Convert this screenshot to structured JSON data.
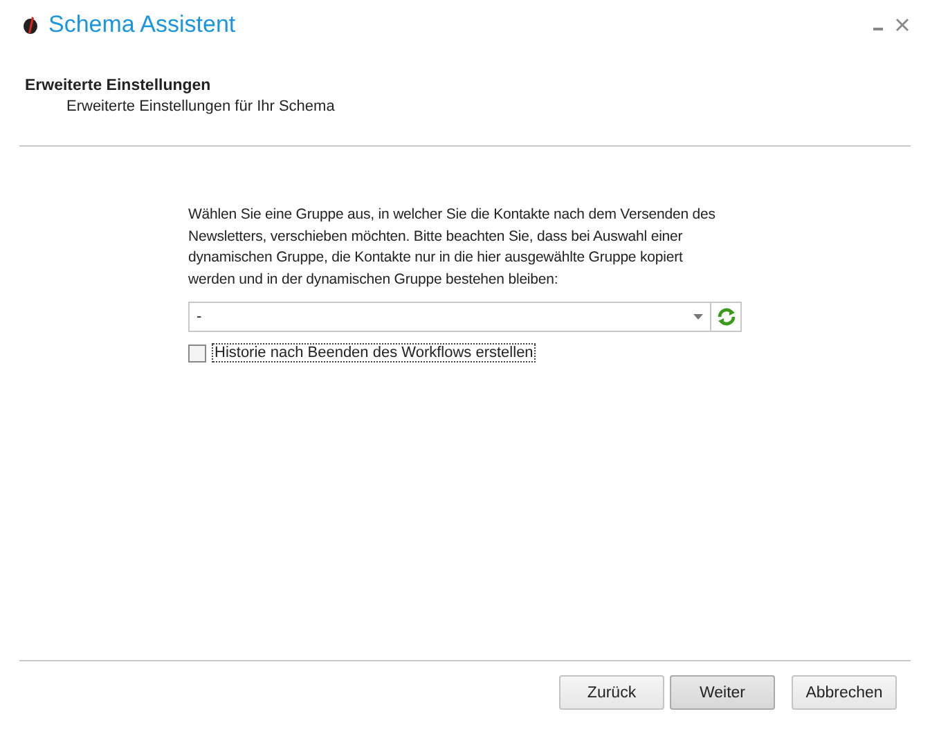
{
  "window": {
    "title": "Schema Assistent"
  },
  "header": {
    "title": "Erweiterte Einstellungen",
    "subtitle": "Erweiterte Einstellungen für Ihr Schema"
  },
  "content": {
    "description": "Wählen Sie eine Gruppe aus, in welcher Sie die Kontakte nach dem Versenden des Newsletters, verschieben möchten. Bitte beachten Sie, dass bei Auswahl einer dynamischen Gruppe, die Kontakte nur in die hier ausgewählte Gruppe kopiert werden und in der dynamischen Gruppe bestehen bleiben:",
    "group_select": {
      "value": "-"
    },
    "history_checkbox": {
      "label": "Historie nach Beenden des Workflows erstellen",
      "checked": false,
      "focused": true
    }
  },
  "buttons": [
    {
      "label": "Zurück",
      "default": false
    },
    {
      "label": "Weiter",
      "default": true
    },
    {
      "label": "Abbrechen",
      "default": false
    }
  ]
}
